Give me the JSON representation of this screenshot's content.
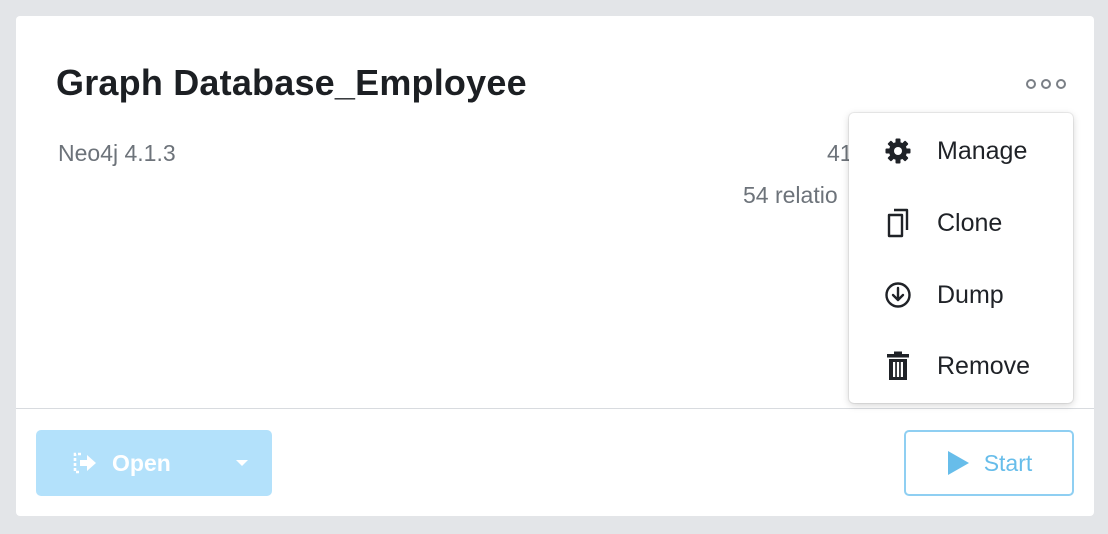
{
  "database": {
    "title": "Graph Database_Employee",
    "version": "Neo4j 4.1.3",
    "nodes_stat": "41",
    "relationships_stat": "54 relatio"
  },
  "more_menu": {
    "icon": "more-horizontal-icon",
    "items": [
      {
        "label": "Manage",
        "icon": "gear-icon"
      },
      {
        "label": "Clone",
        "icon": "copy-icon"
      },
      {
        "label": "Dump",
        "icon": "download-circle-icon"
      },
      {
        "label": "Remove",
        "icon": "trash-icon"
      }
    ]
  },
  "actions": {
    "open_label": "Open",
    "open_icon": "open-app-icon",
    "start_label": "Start",
    "start_icon": "play-icon"
  },
  "colors": {
    "open_button_bg": "#b3e1fb",
    "start_button_border": "#8fcff2",
    "start_button_text": "#67bdea"
  }
}
